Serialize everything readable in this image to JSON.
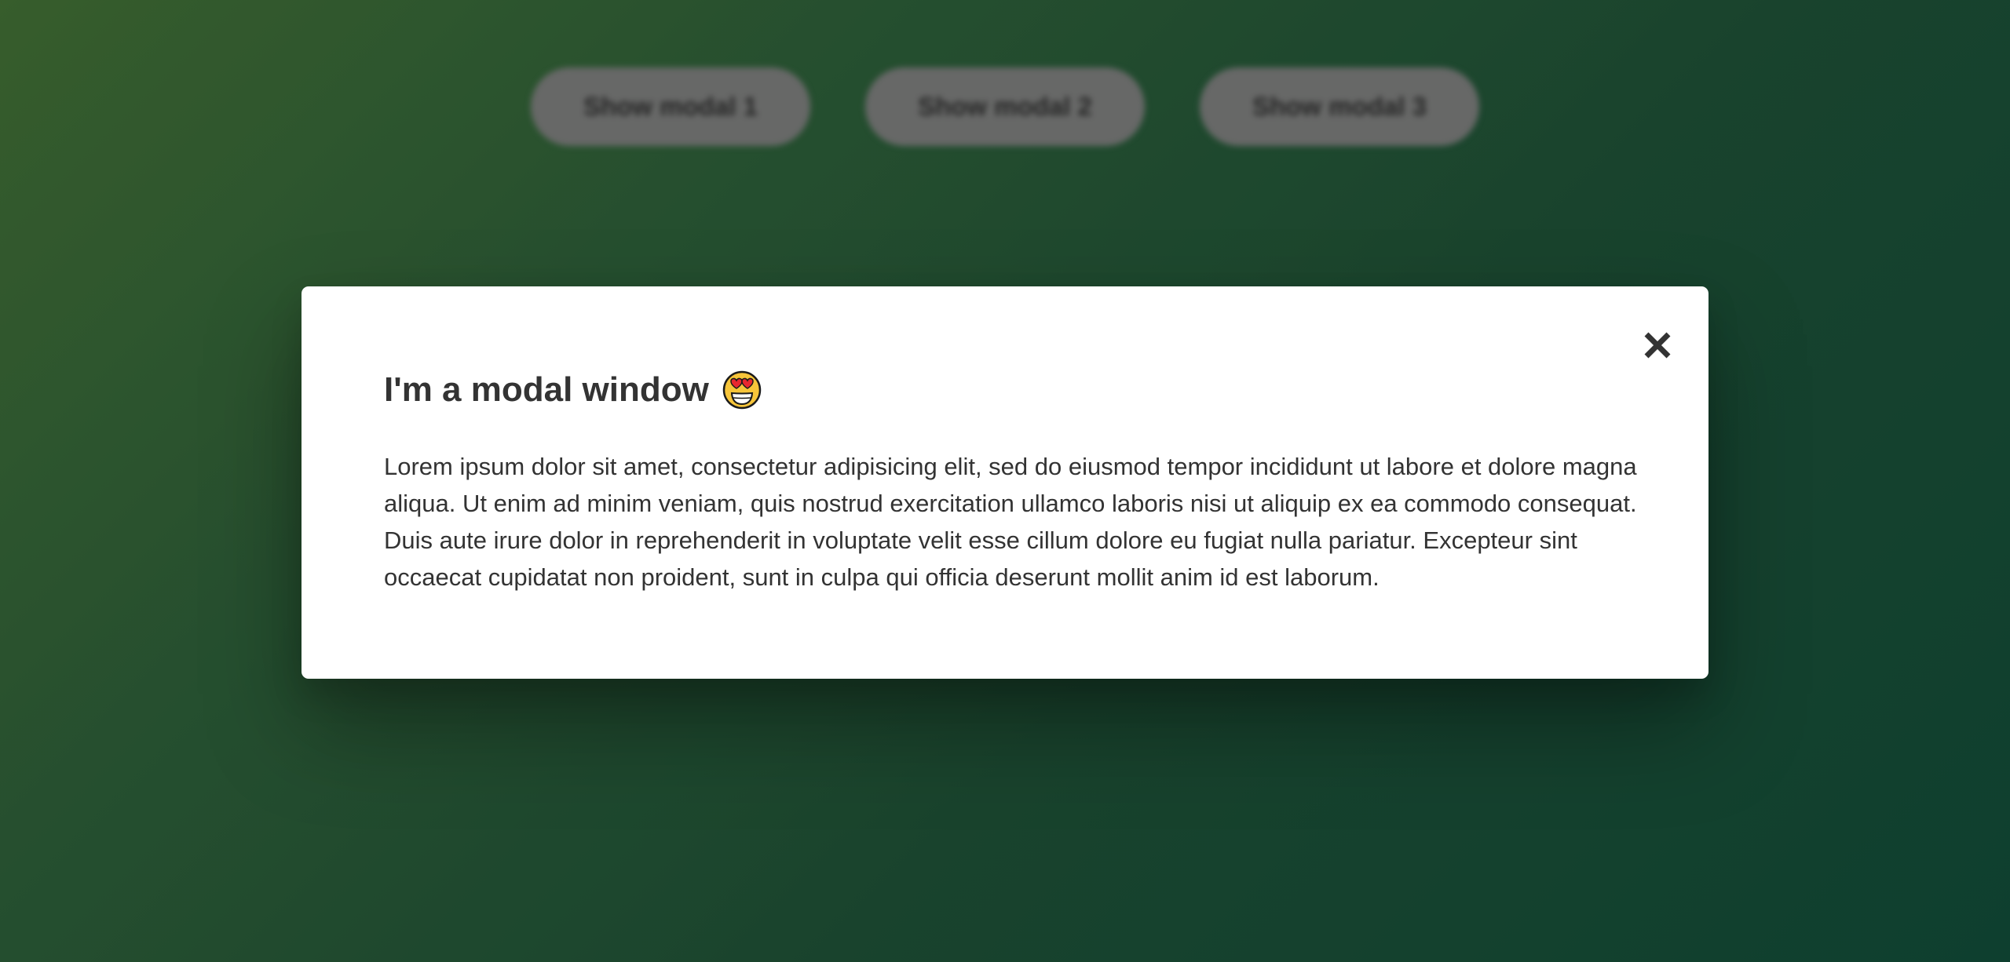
{
  "background": {
    "buttons": [
      {
        "label": "Show modal 1"
      },
      {
        "label": "Show modal 2"
      },
      {
        "label": "Show modal 3"
      }
    ]
  },
  "modal": {
    "title": "I'm a modal window",
    "title_icon": "heart-eyes-emoji-icon",
    "body": "Lorem ipsum dolor sit amet, consectetur adipisicing elit, sed do eiusmod tempor incididunt ut labore et dolore magna aliqua. Ut enim ad minim veniam, quis nostrud exercitation ullamco laboris nisi ut aliquip ex ea commodo consequat. Duis aute irure dolor in reprehenderit in voluptate velit esse cillum dolore eu fugiat nulla pariatur. Excepteur sint occaecat cupidatat non proident, sunt in culpa qui officia deserunt mollit anim id est laborum.",
    "close_icon": "close-icon"
  },
  "colors": {
    "background_start": "#3f6a33",
    "background_end": "#114836",
    "button_bg": "#767776",
    "modal_bg": "#ffffff",
    "text": "#333333"
  }
}
